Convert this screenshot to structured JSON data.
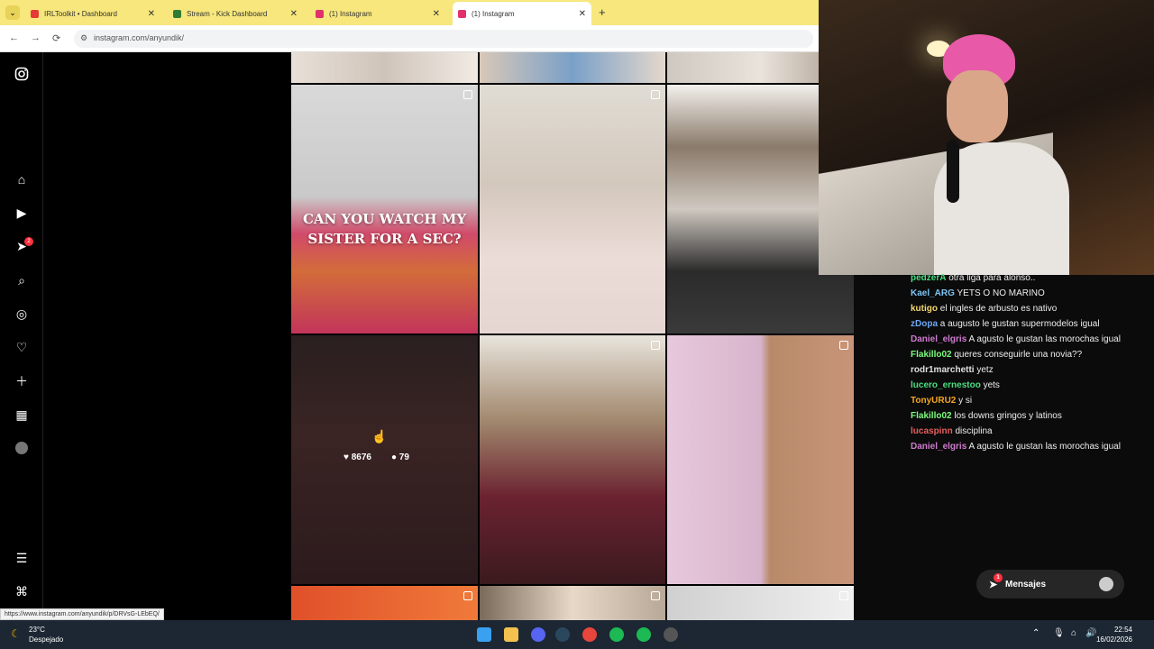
{
  "browser": {
    "tabs": [
      {
        "title": "IRLToolkit • Dashboard",
        "favicon_color": "#e53935"
      },
      {
        "title": "Stream - Kick Dashboard",
        "favicon_color": "#2e7d32"
      },
      {
        "title": "(1) Instagram",
        "favicon_color": "#e1306c"
      },
      {
        "title": "(1) Instagram",
        "favicon_color": "#e1306c"
      }
    ],
    "url": "instagram.com/anyundik/",
    "status_link": "https://www.instagram.com/anyundik/p/DRVsG-LEbEQ/"
  },
  "instagram": {
    "nav_badge": "2",
    "post_text_line1": "CAN YOU WATCH MY",
    "post_text_line2": "SISTER FOR A SEC?",
    "hover_likes": "8676",
    "hover_comments": "79"
  },
  "chat": {
    "messages": [
      {
        "user": "pedzerA",
        "color": "#4ade80",
        "text": "otra liga para alonso.."
      },
      {
        "user": "Kael_ARG",
        "color": "#7cc4f5",
        "text": "YETS O NO MARINO"
      },
      {
        "user": "kutigo",
        "color": "#f5d76e",
        "text": "el ingles de arbusto es nativo"
      },
      {
        "user": "zDopa",
        "color": "#6ea8f5",
        "text": "a augusto le gustan supermodelos igual"
      },
      {
        "user": "Daniel_elgris",
        "color": "#d07bd0",
        "text": "A agusto le gustan las morochas igual"
      },
      {
        "user": "Flakillo02",
        "color": "#7cfc7c",
        "text": "queres conseguirle una novia??"
      },
      {
        "user": "rodr1marchetti",
        "color": "#e0e0e0",
        "text": "yetz"
      },
      {
        "user": "lucero_ernestoo",
        "color": "#4ade80",
        "text": "yets"
      },
      {
        "user": "TonyURU2",
        "color": "#f5a623",
        "text": "y si"
      },
      {
        "user": "Flakillo02",
        "color": "#7cfc7c",
        "text": "los downs gringos y latinos"
      },
      {
        "user": "lucaspinn",
        "color": "#e85d5d",
        "text": "disciplina"
      },
      {
        "user": "Daniel_elgris",
        "color": "#d07bd0",
        "text": "A agusto le gustan las morochas igual"
      }
    ],
    "messages_button": "Mensajes",
    "messages_badge": "1"
  },
  "taskbar": {
    "temperature": "23°C",
    "weather": "Despejado",
    "time": "22:54",
    "date": "16/02/2026"
  }
}
